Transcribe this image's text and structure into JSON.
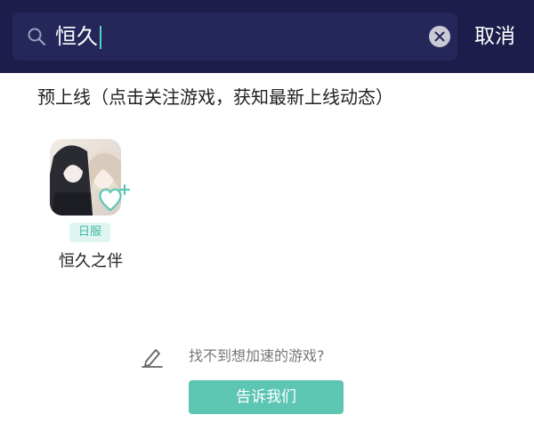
{
  "search": {
    "query": "恒久",
    "cancel_label": "取消"
  },
  "section": {
    "title": "预上线（点击关注游戏，获知最新上线动态）"
  },
  "games": [
    {
      "name": "恒久之伴",
      "region_badge": "日服"
    }
  ],
  "footer": {
    "hint": "找不到想加速的游戏?",
    "button_label": "告诉我们"
  },
  "colors": {
    "topbar": "#1c1d4a",
    "search_box": "#25275a",
    "accent": "#5cc6b3",
    "badge_bg": "#e0f5f1",
    "badge_text": "#3fb8a5"
  },
  "icons": [
    "search-icon",
    "clear-icon",
    "heart-plus-icon",
    "pencil-icon"
  ]
}
